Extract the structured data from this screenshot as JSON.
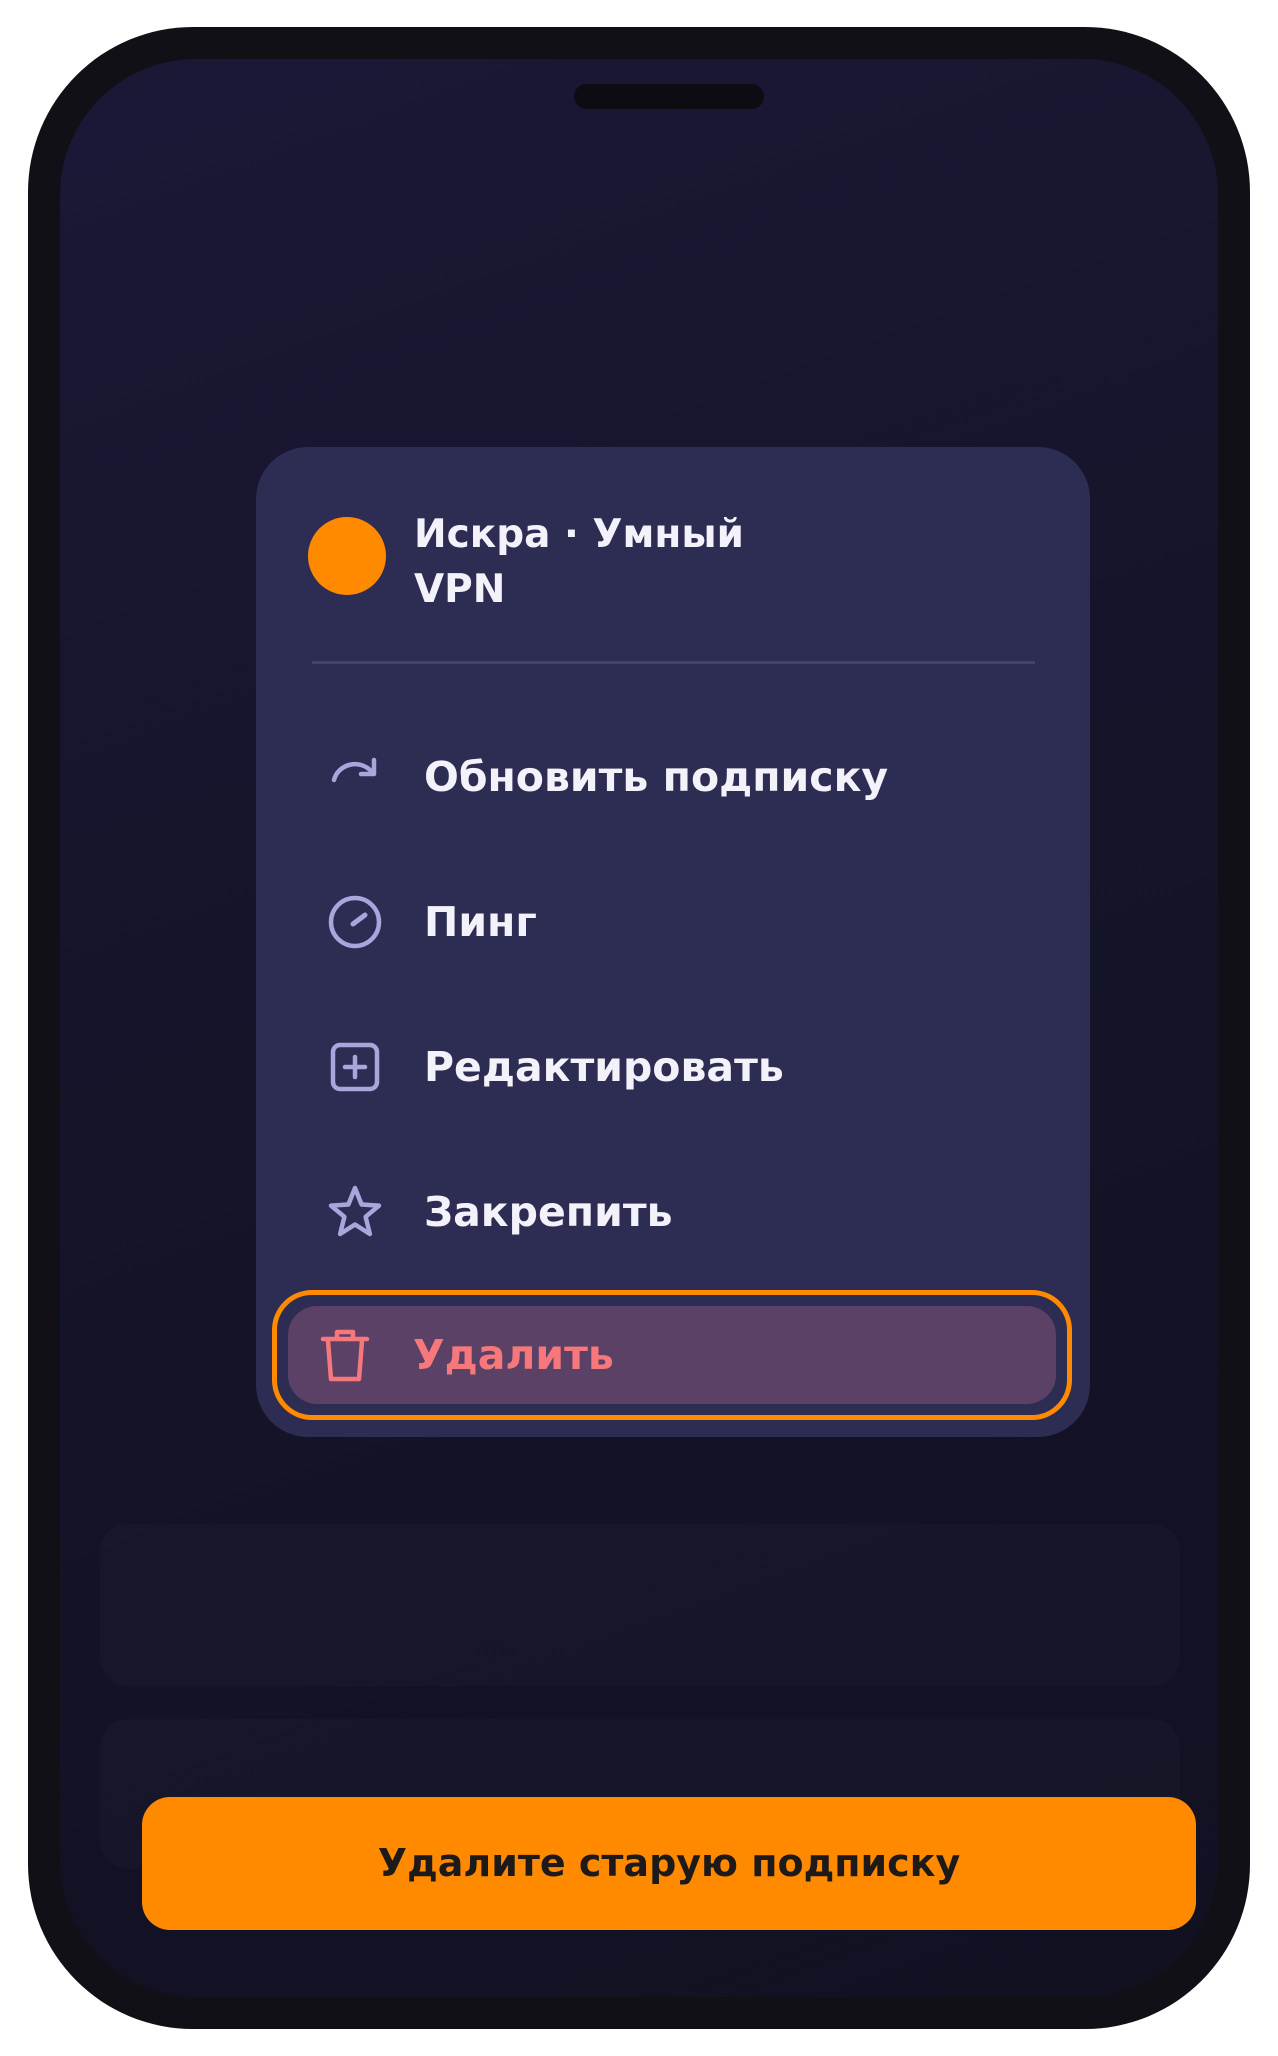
{
  "subscription": {
    "name_line1": "Искра · Умный",
    "name_line2": "VPN",
    "avatar_color": "#ff8a00"
  },
  "menu": {
    "items": [
      {
        "label": "Обновить подписку",
        "icon": "refresh-icon"
      },
      {
        "label": "Пинг",
        "icon": "speedometer-icon"
      },
      {
        "label": "Редактировать",
        "icon": "edit-plus-icon"
      },
      {
        "label": "Закрепить",
        "icon": "star-icon"
      },
      {
        "label": "Удалить",
        "icon": "trash-icon",
        "highlighted": true,
        "color": "#f7787c"
      }
    ]
  },
  "cta": {
    "label": "Удалите старую подписку",
    "color": "#ff8a00"
  },
  "colors": {
    "accent": "#ff8a00",
    "menu_background": "#2d2c52",
    "danger": "#f7787c",
    "icon": "#a9a6dc"
  }
}
